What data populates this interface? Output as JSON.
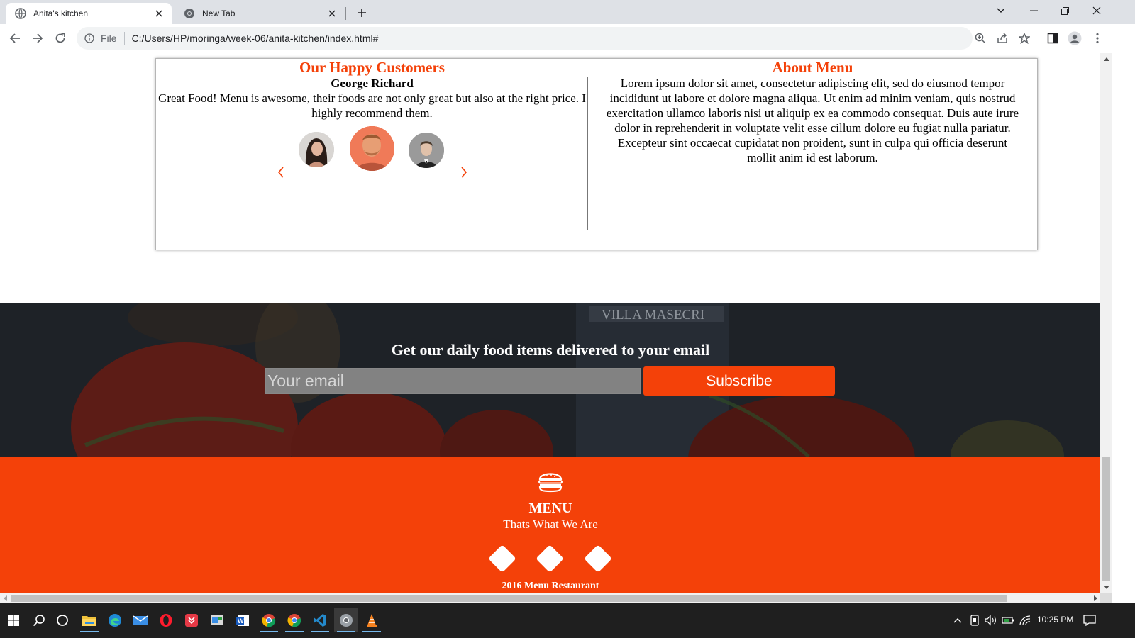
{
  "browser": {
    "tabs": [
      {
        "title": "Anita's kitchen",
        "active": true
      },
      {
        "title": "New Tab",
        "active": false
      }
    ],
    "address": {
      "scheme_label": "File",
      "url": "C:/Users/HP/moringa/week-06/anita-kitchen/index.html#"
    }
  },
  "testimonials": {
    "title": "Our Happy Customers",
    "customer_name": "George Richard",
    "quote": "Great Food! Menu is awesome, their foods are not only great but also at the right price. I highly recommend them."
  },
  "about": {
    "title": "About Menu",
    "body": "Lorem ipsum dolor sit amet, consectetur adipiscing elit, sed do eiusmod tempor incididunt ut labore et dolore magna aliqua. Ut enim ad minim veniam, quis nostrud exercitation ullamco laboris nisi ut aliquip ex ea commodo consequat. Duis aute irure dolor in reprehenderit in voluptate velit esse cillum dolore eu fugiat nulla pariatur. Excepteur sint occaecat cupidatat non proident, sunt in culpa qui officia deserunt mollit anim id est laborum."
  },
  "newsletter": {
    "heading": "Get our daily food items delivered to your email",
    "email_placeholder": "Your email",
    "subscribe_label": "Subscribe"
  },
  "footer": {
    "title": "MENU",
    "tagline": "Thats What We Are",
    "copyright": "2016 Menu Restaurant"
  },
  "taskbar": {
    "clock": "10:25 PM"
  },
  "colors": {
    "accent": "#f44109",
    "newsletter_bg": "#1d2126",
    "tabbar_bg": "#dee1e6",
    "taskbar_bg": "#1f1f1f"
  },
  "icons": {
    "tab_favicons": [
      "globe-icon",
      "chrome-icon"
    ],
    "nav": [
      "back-arrow-icon",
      "forward-arrow-icon",
      "reload-icon"
    ],
    "toolbar": [
      "zoom-icon",
      "share-icon",
      "bookmark-star-icon",
      "side-panel-icon",
      "profile-icon",
      "kebab-menu-icon"
    ],
    "footer_logo": "burger-icon",
    "carousel": [
      "chevron-left-icon",
      "chevron-right-icon"
    ]
  }
}
